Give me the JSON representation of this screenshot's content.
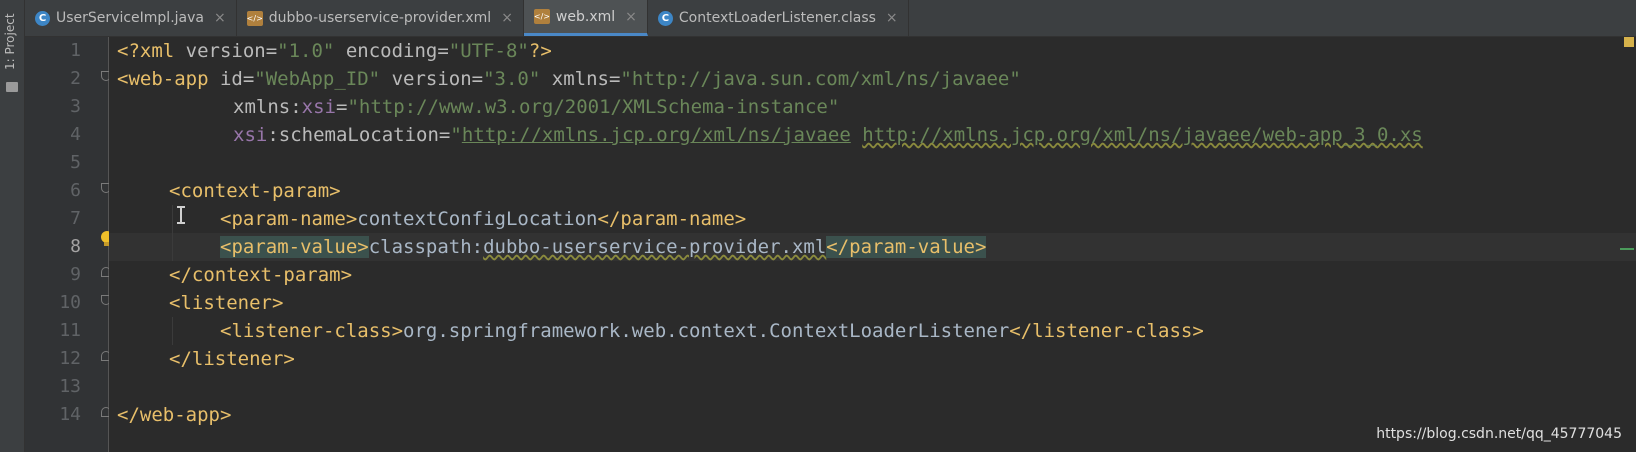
{
  "toolstrip": {
    "project_label": "1: Project"
  },
  "tabs": [
    {
      "label": "UserServiceImpl.java",
      "icon": "java-class-icon"
    },
    {
      "label": "dubbo-userservice-provider.xml",
      "icon": "xml-file-icon"
    },
    {
      "label": "web.xml",
      "icon": "xml-file-icon",
      "active": true
    },
    {
      "label": "ContextLoaderListener.class",
      "icon": "java-class-icon"
    }
  ],
  "tab_close_glyph": "×",
  "line_numbers": [
    "1",
    "2",
    "3",
    "4",
    "5",
    "6",
    "7",
    "8",
    "9",
    "10",
    "11",
    "12",
    "13",
    "14"
  ],
  "current_line": 8,
  "code": {
    "l1": {
      "open": "<?xml ",
      "attr1": "version",
      "eq1": "=",
      "v1": "\"1.0\"",
      "sp": " ",
      "attr2": "encoding",
      "eq2": "=",
      "v2": "\"UTF-8\"",
      "close": "?>"
    },
    "l2": {
      "tag": "<web-app ",
      "a1": "id",
      "e1": "=",
      "v1": "\"WebApp_ID\"",
      "a2": " version",
      "e2": "=",
      "v2": "\"3.0\"",
      "a3": " xmlns",
      "e3": "=",
      "v3": "\"http://java.sun.com/xml/ns/javaee\""
    },
    "l3": {
      "a1": "xmlns",
      "c": ":",
      "ns": "xsi",
      "e": "=",
      "v": "\"http://www.w3.org/2001/XMLSchema-instance\""
    },
    "l4": {
      "ns": "xsi",
      "a": ":schemaLocation",
      "e": "=",
      "q": "\"",
      "u1": "http://xmlns.jcp.org/xml/ns/javaee",
      "sp": " ",
      "u2": "http://xmlns.jcp.org/xml/ns/javaee/web-app_3_0.xs"
    },
    "l6": {
      "tag": "<context-param>"
    },
    "l7": {
      "open": "<param-name>",
      "text": "contextConfigLocation",
      "close": "</param-name>"
    },
    "l8": {
      "open": "<param-value>",
      "text1": "classpath:",
      "text2": "dubbo-userservice-provider.xml",
      "close": "</param-value>"
    },
    "l9": {
      "tag": "</context-param>"
    },
    "l10": {
      "tag": "<listener>"
    },
    "l11": {
      "open": "<listener-class>",
      "text": "org.springframework.web.context.ContextLoaderListener",
      "close": "</listener-class>"
    },
    "l12": {
      "tag": "</listener>"
    },
    "l14": {
      "tag": "</web-app>"
    }
  },
  "watermark": "https://blog.csdn.net/qq_45777045",
  "colors": {
    "background": "#2b2b2b",
    "tag": "#e8bf6a",
    "attribute": "#bababa",
    "namespace": "#9876aa",
    "string": "#6a8759",
    "active_tab": "#4e5254"
  }
}
